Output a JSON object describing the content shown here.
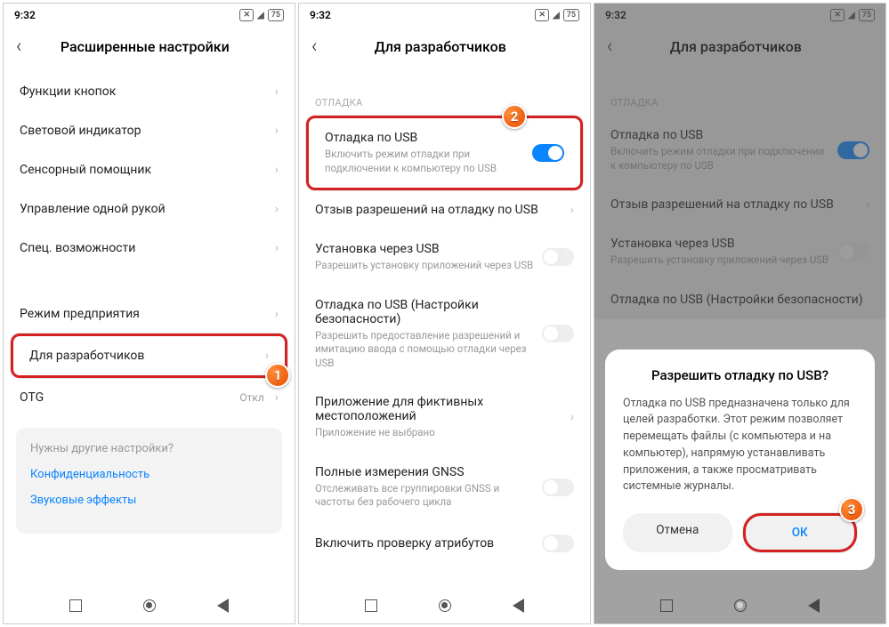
{
  "status": {
    "time": "9:32",
    "batt": "75"
  },
  "p1": {
    "title": "Расширенные настройки",
    "rows": [
      {
        "label": "Функции кнопок"
      },
      {
        "label": "Световой индикатор"
      },
      {
        "label": "Сенсорный помощник"
      },
      {
        "label": "Управление одной рукой"
      },
      {
        "label": "Спец. возможности"
      }
    ],
    "rows2": [
      {
        "label": "Режим предприятия"
      },
      {
        "label": "Для разработчиков"
      },
      {
        "label": "OTG",
        "value": "Откл"
      }
    ],
    "suggest": {
      "q": "Нужны другие настройки?",
      "link1": "Конфиденциальность",
      "link2": "Звуковые эффекты"
    }
  },
  "p2": {
    "title": "Для разработчиков",
    "section": "ОТЛАДКА",
    "rows": [
      {
        "label": "Отладка по USB",
        "sub": "Включить режим отладки при подключении к компьютеру по USB"
      },
      {
        "label": "Отзыв разрешений на отладку по USB"
      },
      {
        "label": "Установка через USB",
        "sub": "Разрешить установку приложений через USB"
      },
      {
        "label": "Отладка по USB (Настройки безопасности)",
        "sub": "Разрешить предоставление разрешений и имитацию ввода с помощью отладки через USB"
      },
      {
        "label": "Приложение для фиктивных местоположений",
        "sub": "Приложение не выбрано"
      },
      {
        "label": "Полные измерения GNSS",
        "sub": "Отслеживать все группировки GNSS и частоты без рабочего цикла"
      },
      {
        "label": "Включить проверку атрибутов"
      }
    ]
  },
  "p3": {
    "title": "Для разработчиков",
    "section": "ОТЛАДКА",
    "rows": [
      {
        "label": "Отладка по USB",
        "sub": "Включить режим отладки при подключении к компьютеру по USB"
      },
      {
        "label": "Отзыв разрешений на отладку по USB"
      },
      {
        "label": "Установка через USB",
        "sub": "Разрешить установку приложений через USB"
      },
      {
        "label": "Отладка по USB (Настройки безопасности)"
      }
    ],
    "dialog": {
      "title": "Разрешить отладку по USB?",
      "body": "Отладка по USB предназначена только для целей разработки. Этот режим позволяет перемещать файлы (с компьютера и на компьютер), напрямую устанавливать приложения, а также просматривать системные журналы.",
      "cancel": "Отмена",
      "ok": "ОК"
    }
  },
  "badges": {
    "b1": "1",
    "b2": "2",
    "b3": "3"
  }
}
